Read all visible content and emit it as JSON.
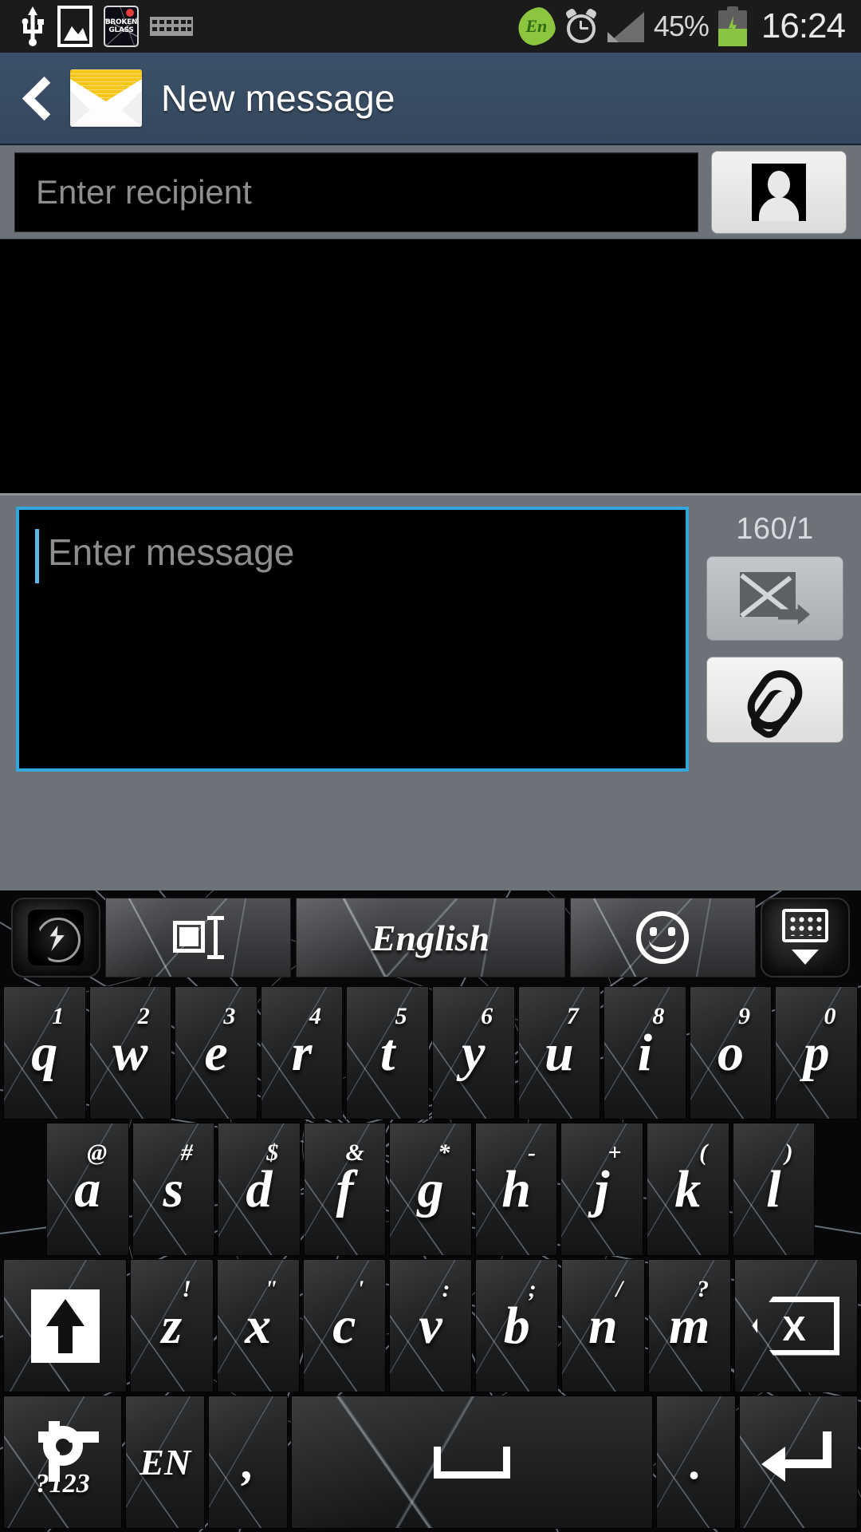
{
  "status_bar": {
    "left_icons": [
      "usb-icon",
      "gallery-icon",
      "broken-glass-app-icon",
      "keyboard-icon"
    ],
    "broken_glass_label_line1": "BROKEN",
    "broken_glass_label_line2": "GLASS",
    "language_indicator": "En",
    "right_icons": [
      "alarm-icon",
      "signal-icon",
      "battery-charging-icon"
    ],
    "battery_percent": "45%",
    "clock": "16:24"
  },
  "action_bar": {
    "back_label": "Back",
    "icon": "envelope-icon",
    "title": "New message",
    "background_color": "#3b5169"
  },
  "recipient": {
    "placeholder": "Enter recipient",
    "value": "",
    "contacts_button_icon": "person-icon"
  },
  "compose": {
    "placeholder": "Enter message",
    "value": "",
    "char_counter": "160/1",
    "send_button_icon": "send-message-icon",
    "attach_button_icon": "paperclip-icon",
    "focus_border_color": "#32a6dd"
  },
  "keyboard": {
    "theme": "broken-glass",
    "toolbar": {
      "theme_icon": "theme-logo-icon",
      "text_select_icon": "text-select-icon",
      "language_label": "English",
      "emoji_icon": "smiley-icon",
      "hide_keyboard_icon": "hide-keyboard-icon"
    },
    "rows": [
      [
        {
          "label": "q",
          "sup": "1"
        },
        {
          "label": "w",
          "sup": "2"
        },
        {
          "label": "e",
          "sup": "3"
        },
        {
          "label": "r",
          "sup": "4"
        },
        {
          "label": "t",
          "sup": "5"
        },
        {
          "label": "y",
          "sup": "6"
        },
        {
          "label": "u",
          "sup": "7"
        },
        {
          "label": "i",
          "sup": "8"
        },
        {
          "label": "o",
          "sup": "9"
        },
        {
          "label": "p",
          "sup": "0"
        }
      ],
      [
        {
          "label": "a",
          "sup": "@"
        },
        {
          "label": "s",
          "sup": "#"
        },
        {
          "label": "d",
          "sup": "$"
        },
        {
          "label": "f",
          "sup": "&"
        },
        {
          "label": "g",
          "sup": "*"
        },
        {
          "label": "h",
          "sup": "-"
        },
        {
          "label": "j",
          "sup": "+"
        },
        {
          "label": "k",
          "sup": "("
        },
        {
          "label": "l",
          "sup": ")"
        }
      ],
      [
        {
          "label": "z",
          "sup": "!"
        },
        {
          "label": "x",
          "sup": "\""
        },
        {
          "label": "c",
          "sup": "'"
        },
        {
          "label": "v",
          "sup": ":"
        },
        {
          "label": "b",
          "sup": ";"
        },
        {
          "label": "n",
          "sup": "/"
        },
        {
          "label": "m",
          "sup": "?"
        }
      ]
    ],
    "shift_key": "shift-icon",
    "backspace_key": "backspace-icon",
    "symbols_key": "?123",
    "lang_key": "EN",
    "comma_key": ",",
    "space_key": "space-icon",
    "period_key": ".",
    "enter_key": "enter-icon"
  }
}
